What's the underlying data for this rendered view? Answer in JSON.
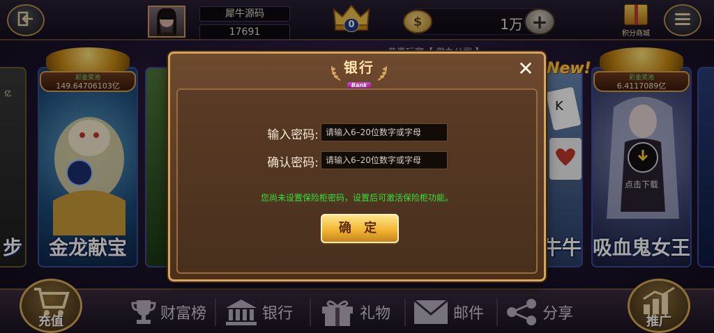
{
  "header": {
    "player_name": "犀牛源码",
    "player_id": "17691",
    "crown_count": "0",
    "coin_balance": "1万",
    "shop_label": "积分商城"
  },
  "background": {
    "marquee_partial": "恭喜玩家【 傲丸公司 】",
    "games": [
      {
        "name": "金龙献宝",
        "jackpot_title": "彩金奖池",
        "jackpot_value": "149.64706103亿"
      },
      {
        "name": "吸血鬼女王",
        "jackpot_title": "彩金奖池",
        "jackpot_value": "6.4117089亿",
        "download_label": "点击下载"
      }
    ],
    "left_partial_name": "步",
    "left_partial_value": "亿",
    "right_partial_name": "牛牛",
    "new_badge": "New!"
  },
  "bottom_nav": {
    "recharge": "充值",
    "wealth_rank": "财富榜",
    "bank": "银行",
    "gift": "礼物",
    "mail": "邮件",
    "share": "分享",
    "promote": "推广"
  },
  "dialog": {
    "title": "银行",
    "subtitle": "Bank",
    "close_glyph": "✕",
    "password_label": "输入密码:",
    "password_placeholder": "请输入6–20位数字或字母",
    "confirm_label": "确认密码:",
    "confirm_placeholder": "请输入6–20位数字或字母",
    "notice": "您尚未设置保险柜密码，设置后可激活保险柜功能。",
    "confirm_button": "确 定"
  },
  "colors": {
    "notice_green": "#37e23a",
    "dialog_border_gold": "#d6a660",
    "confirm_gold": "#f2b735"
  },
  "icons": [
    "exit-icon",
    "menu-icon",
    "crown-icon",
    "coin-icon",
    "plus-icon",
    "gift-icon",
    "download-icon",
    "cart-icon",
    "trophy-icon",
    "bank-icon",
    "gift-box-icon",
    "mail-icon",
    "share-icon",
    "chart-icon",
    "close-icon"
  ]
}
